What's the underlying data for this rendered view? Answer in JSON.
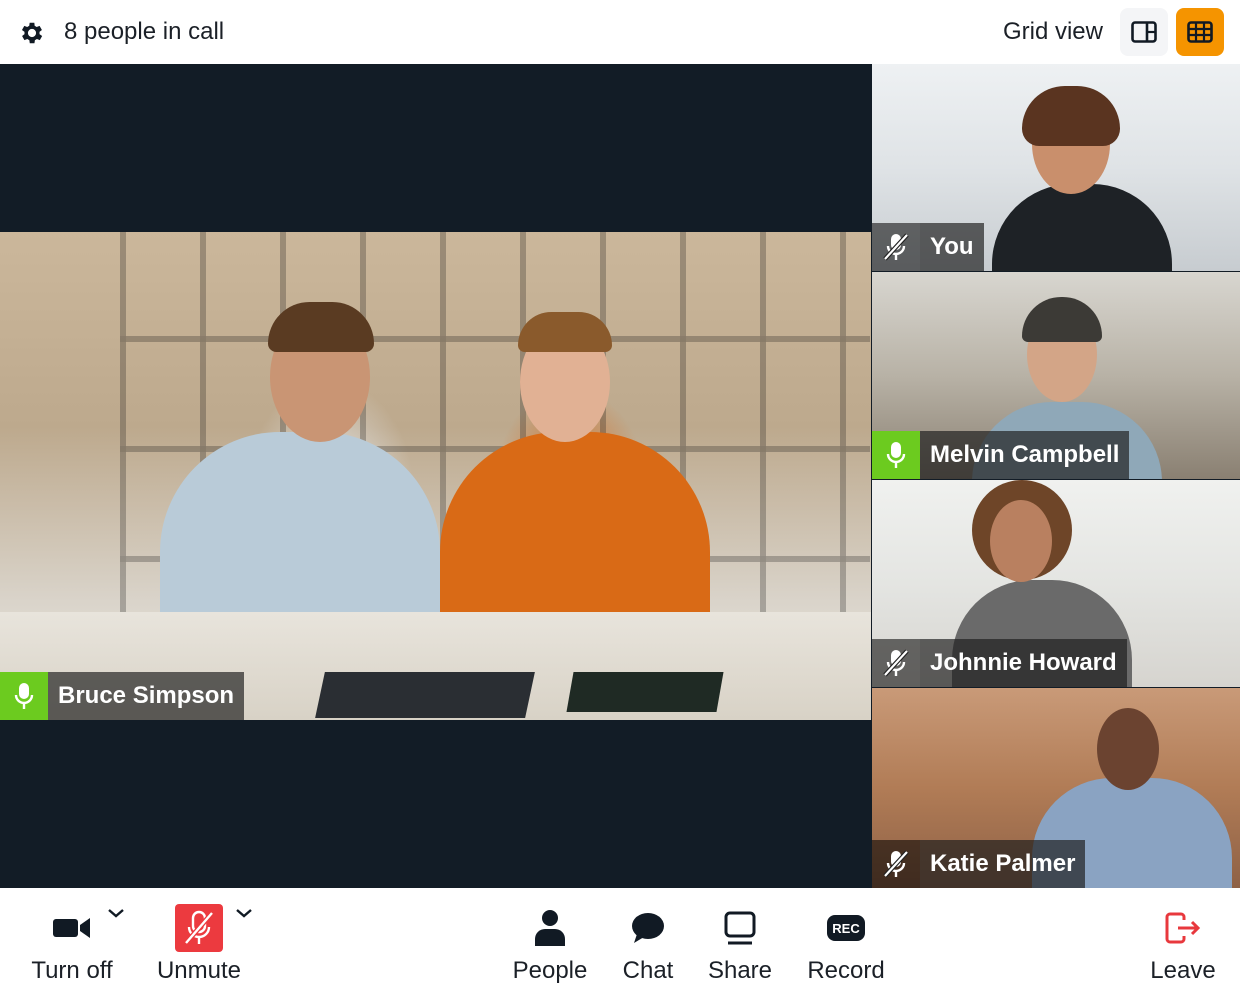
{
  "header": {
    "settings_icon": "gear-icon",
    "people_count_text": "8 people in call",
    "view_label": "Grid view",
    "view_buttons": [
      {
        "name": "sidebar-view",
        "icon": "sidebar-layout-icon",
        "active": false
      },
      {
        "name": "grid-view",
        "icon": "grid-layout-icon",
        "active": true
      }
    ],
    "accent_color": "#f59400"
  },
  "main_speaker": {
    "name": "Bruce Simpson",
    "mic_state": "active",
    "mic_icon": "microphone-icon"
  },
  "participants": [
    {
      "name": "You",
      "mic_state": "muted",
      "mic_icon": "microphone-off-icon"
    },
    {
      "name": "Melvin Campbell",
      "mic_state": "active",
      "mic_icon": "microphone-icon"
    },
    {
      "name": "Johnnie Howard",
      "mic_state": "muted",
      "mic_icon": "microphone-off-icon"
    },
    {
      "name": "Katie Palmer",
      "mic_state": "muted",
      "mic_icon": "microphone-off-icon"
    }
  ],
  "toolbar": {
    "camera": {
      "label": "Turn off",
      "icon": "video-camera-icon",
      "has_dropdown": true
    },
    "mic": {
      "label": "Unmute",
      "icon": "microphone-off-icon",
      "has_dropdown": true,
      "state_color": "#ec3a3f"
    },
    "people": {
      "label": "People",
      "icon": "person-icon"
    },
    "chat": {
      "label": "Chat",
      "icon": "chat-bubble-icon"
    },
    "share": {
      "label": "Share",
      "icon": "screen-share-icon"
    },
    "record": {
      "label": "Record",
      "icon": "rec-icon",
      "badge_text": "REC"
    },
    "leave": {
      "label": "Leave",
      "icon": "leave-icon",
      "color": "#e8383d"
    }
  },
  "colors": {
    "stage_bg": "#121c26",
    "active_mic": "#6ccb1f"
  }
}
